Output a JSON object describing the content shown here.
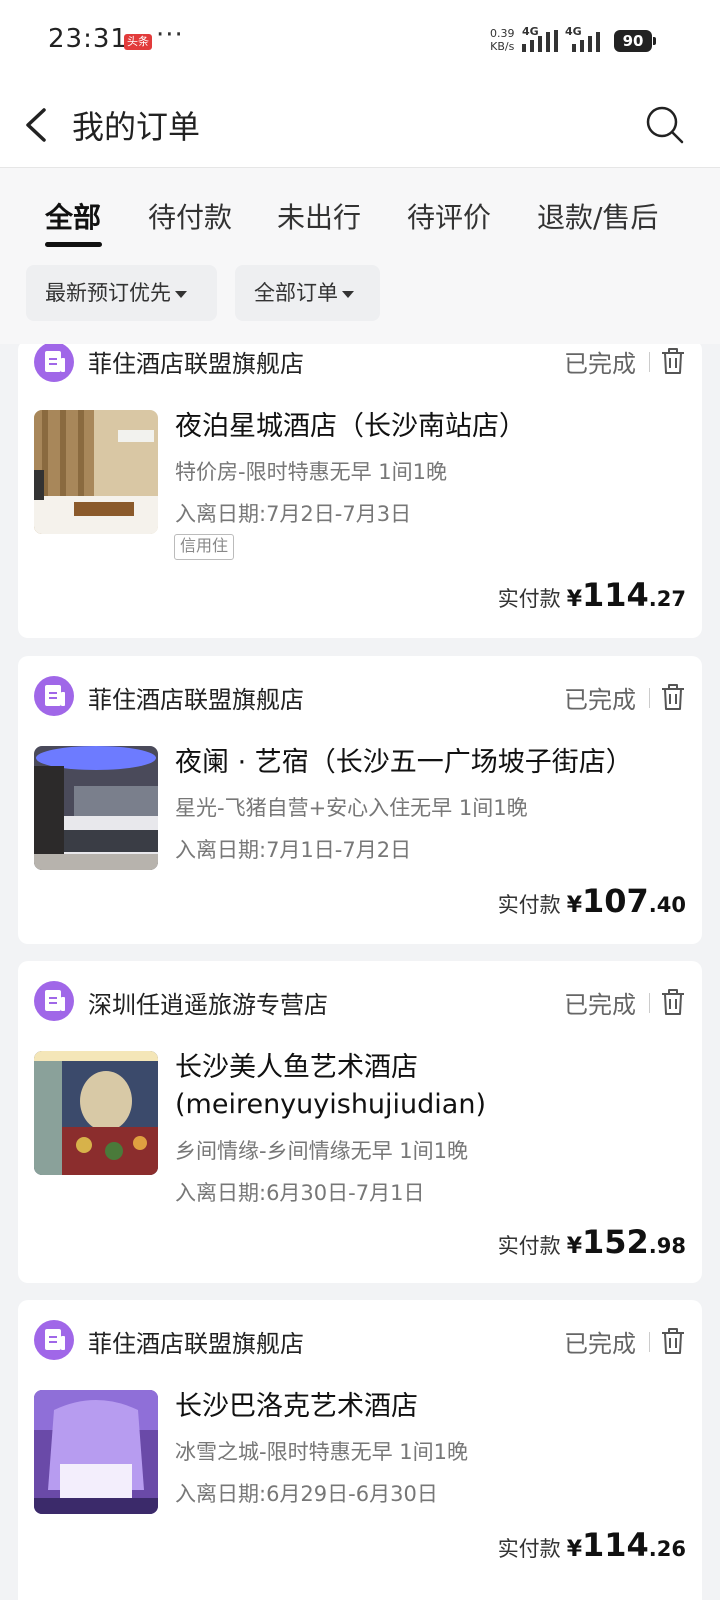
{
  "status_bar": {
    "time": "23:31",
    "news_badge": "头条",
    "more": "···",
    "speed_value": "0.39",
    "speed_unit": "KB/s",
    "network_1": "4G",
    "network_2": "4G",
    "battery": "90"
  },
  "header": {
    "title": "我的订单",
    "back_icon": "chevron-left-icon",
    "search_icon": "search-icon"
  },
  "tabs": [
    {
      "label": "全部",
      "active": true
    },
    {
      "label": "待付款",
      "active": false
    },
    {
      "label": "未出行",
      "active": false
    },
    {
      "label": "待评价",
      "active": false
    },
    {
      "label": "退款/售后",
      "active": false
    }
  ],
  "filters": [
    {
      "label": "最新预订优先"
    },
    {
      "label": "全部订单"
    }
  ],
  "orders": [
    {
      "shop": "菲住酒店联盟旗舰店",
      "status": "已完成",
      "hotel": "夜泊星城酒店（长沙南站店）",
      "room": "特价房-限时特惠无早 1间1晚",
      "dates": "入离日期:7月2日-7月3日",
      "tag": "信用住",
      "price_label": "实付款",
      "currency": "¥",
      "price_int": "114",
      "price_dec": ".27"
    },
    {
      "shop": "菲住酒店联盟旗舰店",
      "status": "已完成",
      "hotel": "夜阑 · 艺宿（长沙五一广场坡子街店）",
      "room": "星光-飞猪自营+安心入住无早 1间1晚",
      "dates": "入离日期:7月1日-7月2日",
      "price_label": "实付款",
      "currency": "¥",
      "price_int": "107",
      "price_dec": ".40"
    },
    {
      "shop": "深圳任逍遥旅游专营店",
      "status": "已完成",
      "hotel": "长沙美人鱼艺术酒店(meirenyuyishujiudian)",
      "room": "乡间情缘-乡间情缘无早 1间1晚",
      "dates": "入离日期:6月30日-7月1日",
      "price_label": "实付款",
      "currency": "¥",
      "price_int": "152",
      "price_dec": ".98"
    },
    {
      "shop": "菲住酒店联盟旗舰店",
      "status": "已完成",
      "hotel": "长沙巴洛克艺术酒店",
      "room": "冰雪之城-限时特惠无早 1间1晚",
      "dates": "入离日期:6月29日-6月30日",
      "price_label": "实付款",
      "currency": "¥",
      "price_int": "114",
      "price_dec": ".26"
    }
  ],
  "colors": {
    "accent_shop_icon": "#a067e8",
    "background": "#f2f3f5",
    "card": "#ffffff"
  }
}
